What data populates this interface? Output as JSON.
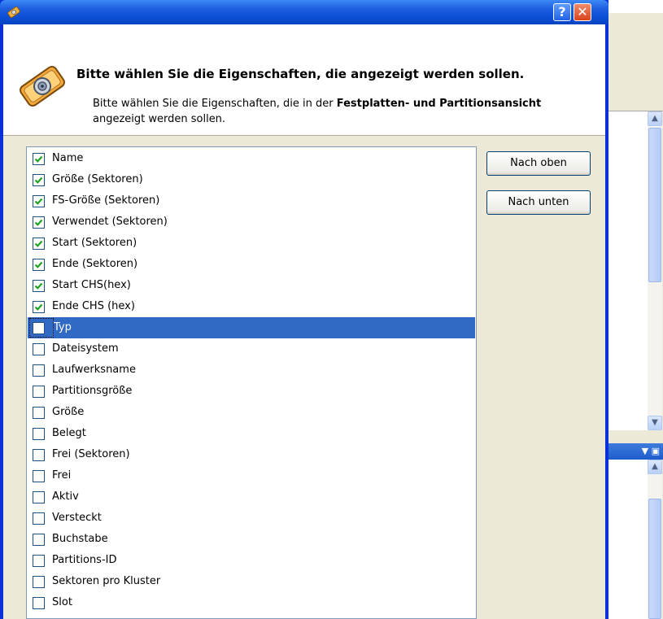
{
  "dialog": {
    "close_glyph": "✕",
    "help_glyph": "?",
    "header_title": "Bitte wählen Sie die Eigenschaften, die angezeigt werden sollen.",
    "header_desc": {
      "part1": "Bitte wählen Sie die Eigenschaften, die in der ",
      "bold": "Festplatten- und Partitionsansicht",
      "part2": " angezeigt werden sollen."
    }
  },
  "buttons": {
    "move_up_label": "Nach oben",
    "move_down_label": "Nach unten"
  },
  "properties": [
    {
      "label": "Name",
      "checked": true
    },
    {
      "label": "Größe (Sektoren)",
      "checked": true
    },
    {
      "label": "FS-Größe (Sektoren)",
      "checked": true
    },
    {
      "label": "Verwendet (Sektoren)",
      "checked": true
    },
    {
      "label": "Start (Sektoren)",
      "checked": true
    },
    {
      "label": "Ende (Sektoren)",
      "checked": true
    },
    {
      "label": "Start CHS(hex)",
      "checked": true
    },
    {
      "label": "Ende CHS (hex)",
      "checked": true
    },
    {
      "label": "Typ",
      "checked": false,
      "selected": true
    },
    {
      "label": "Dateisystem",
      "checked": false
    },
    {
      "label": "Laufwerksname",
      "checked": false
    },
    {
      "label": "Partitionsgröße",
      "checked": false
    },
    {
      "label": "Größe",
      "checked": false
    },
    {
      "label": "Belegt",
      "checked": false
    },
    {
      "label": "Frei (Sektoren)",
      "checked": false
    },
    {
      "label": "Frei",
      "checked": false
    },
    {
      "label": "Aktiv",
      "checked": false
    },
    {
      "label": "Versteckt",
      "checked": false
    },
    {
      "label": "Buchstabe",
      "checked": false
    },
    {
      "label": "Partitions-ID",
      "checked": false
    },
    {
      "label": "Sektoren pro Kluster",
      "checked": false
    },
    {
      "label": "Slot",
      "checked": false
    }
  ],
  "colors": {
    "selection": "#316ac5",
    "check": "#21a121",
    "titlebar": "#0a4fd6"
  },
  "icons": {
    "title_icon": "disk-icon",
    "header_icon": "hard-disk-icon",
    "checkmark": "checkmark-icon"
  }
}
